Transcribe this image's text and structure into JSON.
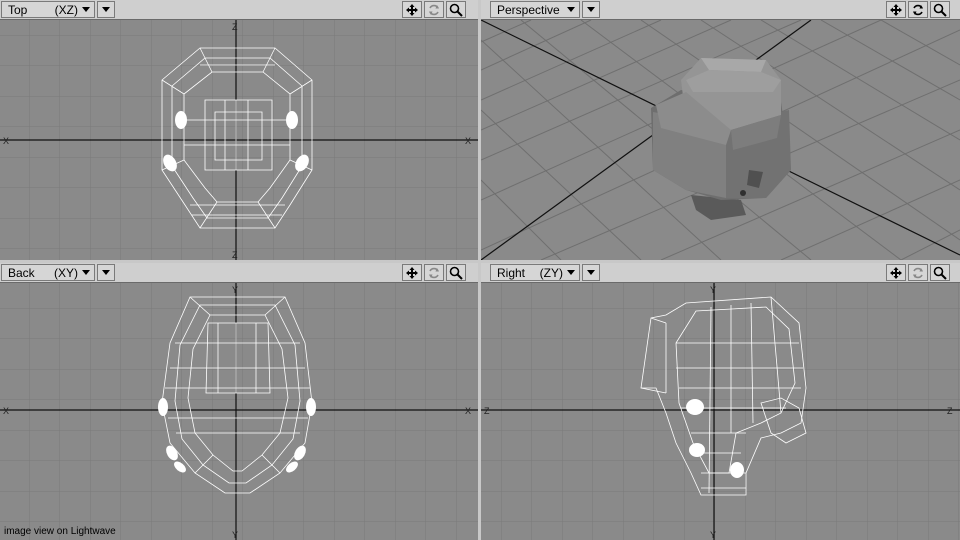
{
  "viewports": {
    "top": {
      "view": "Top",
      "axes": "(XZ)"
    },
    "perspective": {
      "view": "Perspective",
      "axes": ""
    },
    "back": {
      "view": "Back",
      "axes": "(XY)"
    },
    "right": {
      "view": "Right",
      "axes": "(ZY)"
    }
  },
  "axis_labels": {
    "top_h": "X",
    "top_v": "Z",
    "back_h": "X",
    "back_v": "Y",
    "right_h": "Z",
    "right_v": "Y"
  },
  "icons": {
    "move": "move-icon",
    "rotate": "rotate-icon",
    "zoom": "zoom-icon",
    "menu": "dropdown-arrow-icon"
  },
  "colors": {
    "viewport_bg": "#8a8a8a",
    "grid": "#7a7a7a",
    "axis": "#101010",
    "wire": "#ffffff",
    "header": "#cfcfcf"
  },
  "caption": "image view on Lightwave"
}
